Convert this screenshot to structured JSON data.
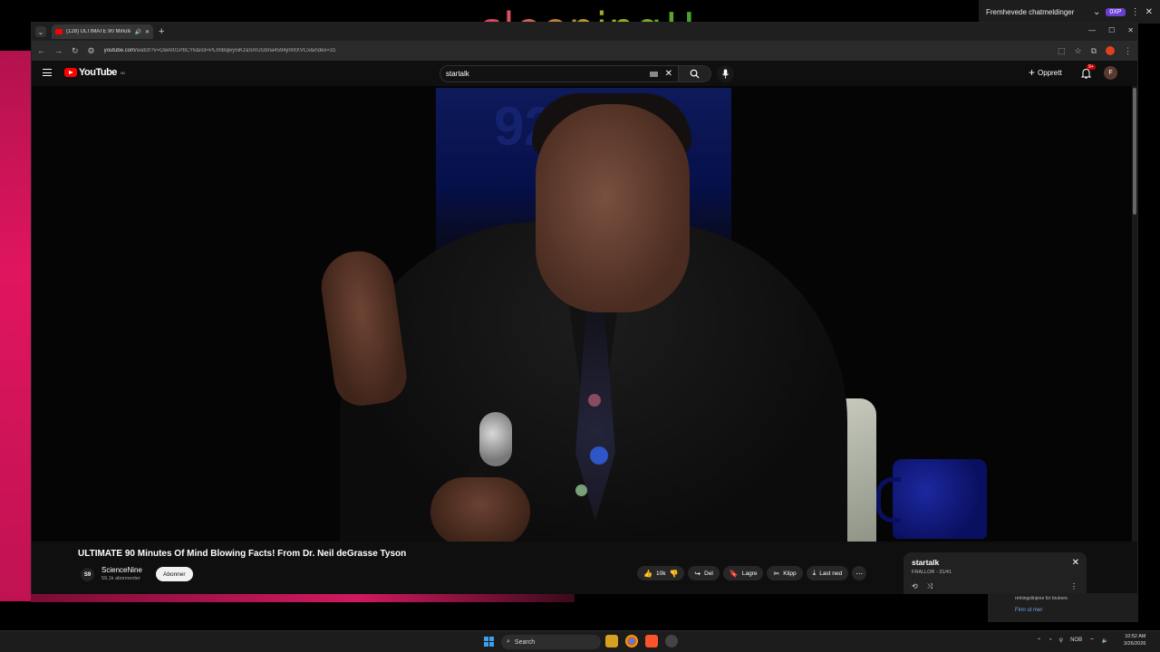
{
  "overlay": {
    "text": "sleeping!!"
  },
  "chat_widget": {
    "title": "Fremhevede chatmeldinger",
    "badge": "0XP"
  },
  "browser": {
    "tab_title": "(128) ULTIMATE 90 Minute",
    "url_site": "youtube.com",
    "url_rest": "/watch?v=OwAt01PbCYk&list=PLmlBqwy5iKzaSmUGbna4594jnlntXVCx&index=31"
  },
  "youtube": {
    "logo_text": "YouTube",
    "logo_region": "NO",
    "search_query": "startalk",
    "create_label": "Opprett",
    "notification_count": "9+",
    "avatar_letter": "F"
  },
  "video": {
    "title": "ULTIMATE 90 Minutes Of Mind Blowing Facts! From Dr. Neil deGrasse Tyson",
    "channel_initials": "S9",
    "channel_name": "ScienceNine",
    "subscribers": "59,1k abonnenter",
    "subscribe_label": "Abonner",
    "likes": "10k",
    "share_label": "Del",
    "save_label": "Lagre",
    "clip_label": "Klipp",
    "download_label": "Last ned"
  },
  "playlist": {
    "title": "startalk",
    "subtitle": "FRALLOR - 31/41"
  },
  "notification": {
    "text": "retningslinjene for brukere.",
    "link": "Finn ut mer"
  },
  "taskbar": {
    "search_label": "Search",
    "lang": "NOB",
    "time": "10:52 AM",
    "date": "3/26/2026"
  },
  "colors": {
    "yt_red": "#ff0000",
    "accent_blue": "#3ea6ff",
    "overlay_green": "#3da030"
  }
}
